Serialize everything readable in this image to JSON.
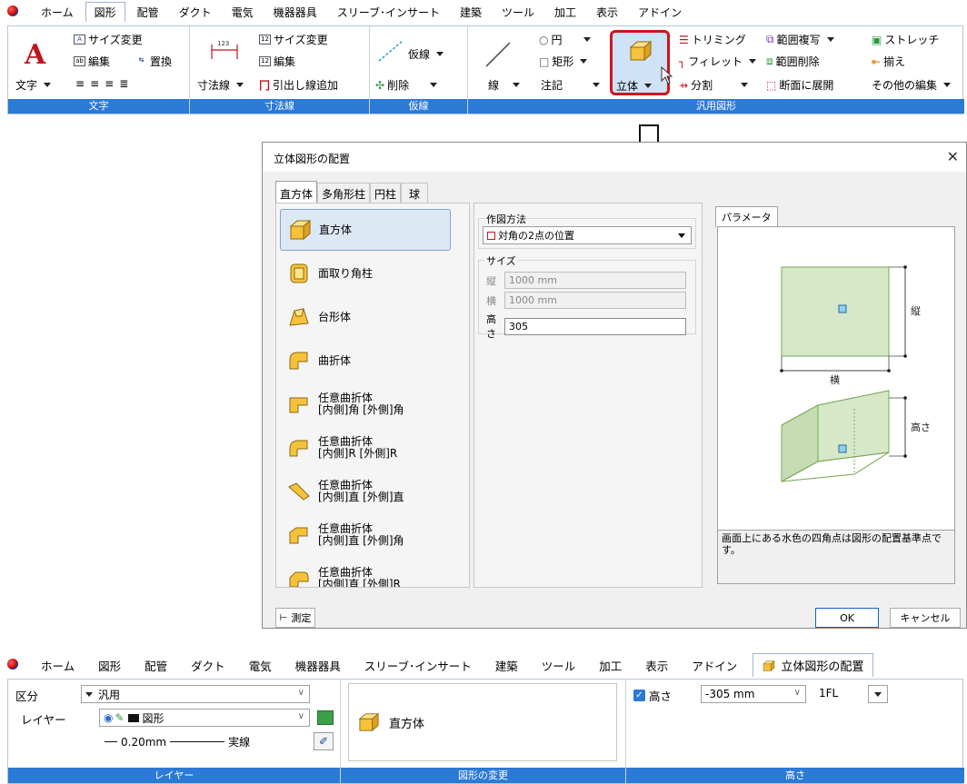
{
  "menu": {
    "items": [
      "ホーム",
      "図形",
      "配管",
      "ダクト",
      "電気",
      "機器器具",
      "スリーブ･インサート",
      "建築",
      "ツール",
      "加工",
      "表示",
      "アドイン"
    ],
    "active": "図形"
  },
  "ribbon": {
    "groups": {
      "text": "文字",
      "dim": "寸法線",
      "temp": "仮線",
      "general": "汎用図形"
    },
    "text": {
      "resize": "サイズ変更",
      "edit": "編集",
      "replace": "置換",
      "text_btn": "文字"
    },
    "dim": {
      "resize": "サイズ変更",
      "edit": "編集",
      "dim_btn": "寸法線",
      "leader_add": "引出し線追加"
    },
    "temp": {
      "temp_line": "仮線",
      "delete": "削除"
    },
    "general": {
      "circle": "円",
      "rect": "矩形",
      "line": "線",
      "note": "注記",
      "solid": "立体",
      "trim": "トリミング",
      "fillet": "フィレット",
      "split": "分割",
      "range_copy": "範囲複写",
      "range_delete": "範囲削除",
      "section_expand": "断面に展開",
      "stretch": "ストレッチ",
      "align": "揃え",
      "other_edit": "その他の編集"
    }
  },
  "dialog": {
    "title": "立体図形の配置",
    "tabs": [
      "直方体",
      "多角形柱",
      "円柱",
      "球"
    ],
    "shapes": [
      {
        "line1": "直方体",
        "line2": ""
      },
      {
        "line1": "面取り角柱",
        "line2": ""
      },
      {
        "line1": "台形体",
        "line2": ""
      },
      {
        "line1": "曲折体",
        "line2": ""
      },
      {
        "line1": "任意曲折体",
        "line2": "[内側]角 [外側]角"
      },
      {
        "line1": "任意曲折体",
        "line2": "[内側]R [外側]R"
      },
      {
        "line1": "任意曲折体",
        "line2": "[内側]直 [外側]直"
      },
      {
        "line1": "任意曲折体",
        "line2": "[内側]直 [外側]角"
      },
      {
        "line1": "任意曲折体",
        "line2": "[内側]直 [外側]R"
      }
    ],
    "method_label": "作図方法",
    "method_value": "対角の2点の位置",
    "size_label": "サイズ",
    "fields": {
      "tate_label": "縦",
      "tate_value": "1000 mm",
      "yoko_label": "横",
      "yoko_value": "1000 mm",
      "height_label": "高さ",
      "height_value": "305"
    },
    "param_tab": "パラメータ",
    "diagram": {
      "tate": "縦",
      "yoko": "横",
      "height": "高さ"
    },
    "note": "画面上にある水色の四角点は図形の配置基準点です。",
    "measure_btn": "測定",
    "ok": "OK",
    "cancel": "キャンセル"
  },
  "menu2": {
    "items": [
      "ホーム",
      "図形",
      "配管",
      "ダクト",
      "電気",
      "機器器具",
      "スリーブ･インサート",
      "建築",
      "ツール",
      "加工",
      "表示",
      "アドイン"
    ],
    "context_tab": "立体図形の配置"
  },
  "ribbon2": {
    "layer": {
      "group": "レイヤー",
      "kubun_label": "区分",
      "kubun_value": "汎用",
      "layer_label": "レイヤー",
      "layer_value": "図形",
      "line_width": "0.20mm",
      "line_type": "実線"
    },
    "shape": {
      "group": "図形の変更",
      "current": "直方体"
    },
    "height": {
      "group": "高さ",
      "check_label": "高さ",
      "value": "-305 mm",
      "floor": "1FL"
    }
  },
  "colors": {
    "accent": "#2b7ad6",
    "highlight": "#d0141c",
    "cube_face": "#f6c23b",
    "diagram_fill": "#d6e8c8"
  }
}
